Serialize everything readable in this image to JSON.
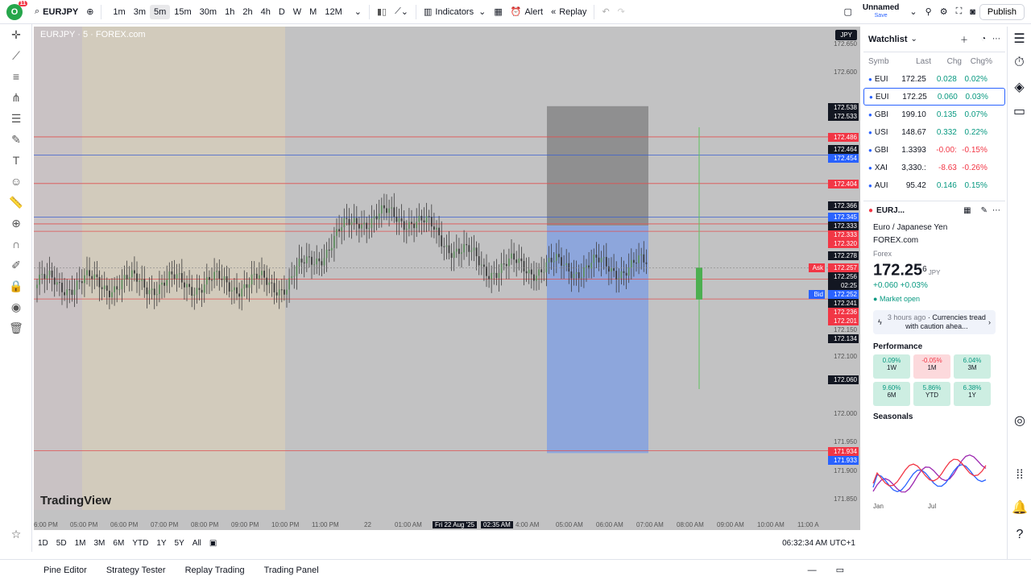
{
  "topbar": {
    "logo_badge": "11",
    "symbol": "EURJPY",
    "timeframes": [
      "1m",
      "3m",
      "5m",
      "15m",
      "30m",
      "1h",
      "2h",
      "4h",
      "D",
      "W",
      "M",
      "12M"
    ],
    "active_tf": "5m",
    "indicators": "Indicators",
    "alert": "Alert",
    "replay": "Replay",
    "layout_name": "Unnamed",
    "layout_sub": "Save",
    "publish": "Publish"
  },
  "chart": {
    "symbol_label": "EURJPY · 5 · FOREX.com",
    "currency": "JPY",
    "watermark": "TradingView",
    "price_labels": [
      {
        "v": "172.650",
        "c": "none"
      },
      {
        "v": "172.600",
        "c": "none"
      },
      {
        "v": "172.538",
        "c": "black"
      },
      {
        "v": "172.533",
        "c": "black"
      },
      {
        "v": "172.486",
        "c": "red"
      },
      {
        "v": "172.464",
        "c": "black"
      },
      {
        "v": "172.454",
        "c": "blue"
      },
      {
        "v": "172.404",
        "c": "red"
      },
      {
        "v": "172.366",
        "c": "black"
      },
      {
        "v": "172.345",
        "c": "blue"
      },
      {
        "v": "172.333",
        "c": "black"
      },
      {
        "v": "172.333",
        "c": "red"
      },
      {
        "v": "172.320",
        "c": "red"
      },
      {
        "v": "172.278",
        "c": "black"
      },
      {
        "v": "172.257",
        "c": "red"
      },
      {
        "v": "172.256",
        "c": "black"
      },
      {
        "v": "02:25",
        "c": "black"
      },
      {
        "v": "172.252",
        "c": "blue"
      },
      {
        "v": "172.241",
        "c": "black"
      },
      {
        "v": "172.236",
        "c": "red"
      },
      {
        "v": "172.201",
        "c": "red"
      },
      {
        "v": "172.150",
        "c": "none"
      },
      {
        "v": "172.134",
        "c": "black"
      },
      {
        "v": "172.100",
        "c": "none"
      },
      {
        "v": "172.060",
        "c": "black"
      },
      {
        "v": "172.000",
        "c": "none"
      },
      {
        "v": "171.950",
        "c": "none"
      },
      {
        "v": "171.934",
        "c": "red"
      },
      {
        "v": "171.933",
        "c": "blue"
      },
      {
        "v": "171.900",
        "c": "none"
      },
      {
        "v": "171.850",
        "c": "none"
      }
    ],
    "ask": "Ask",
    "bid": "Bid",
    "time_labels": [
      "6:00 PM",
      "05:00 PM",
      "06:00 PM",
      "07:00 PM",
      "08:00 PM",
      "09:00 PM",
      "10:00 PM",
      "11:00 PM",
      "22",
      "01:00 AM",
      "Fri 22 Aug '25",
      "02:35 AM",
      "4:00 AM",
      "05:00 AM",
      "06:00 AM",
      "07:00 AM",
      "08:00 AM",
      "09:00 AM",
      "10:00 AM",
      "11:00 A"
    ]
  },
  "bottom": {
    "ranges": [
      "1D",
      "5D",
      "1M",
      "3M",
      "6M",
      "YTD",
      "1Y",
      "5Y",
      "All"
    ],
    "clock": "06:32:34 AM UTC+1"
  },
  "panels": [
    "Pine Editor",
    "Strategy Tester",
    "Replay Trading",
    "Trading Panel"
  ],
  "watchlist": {
    "title": "Watchlist",
    "headers": [
      "Symb",
      "Last",
      "Chg",
      "Chg%"
    ],
    "rows": [
      {
        "sym": "EUI",
        "last": "172.25",
        "chg": "0.028",
        "pct": "0.02%",
        "dir": "pos"
      },
      {
        "sym": "EUI",
        "last": "172.25",
        "chg": "0.060",
        "pct": "0.03%",
        "dir": "pos"
      },
      {
        "sym": "GBI",
        "last": "199.10",
        "chg": "0.135",
        "pct": "0.07%",
        "dir": "pos"
      },
      {
        "sym": "USI",
        "last": "148.67",
        "chg": "0.332",
        "pct": "0.22%",
        "dir": "pos"
      },
      {
        "sym": "GBI",
        "last": "1.3393",
        "chg": "-0.00:",
        "pct": "-0.15%",
        "dir": "neg"
      },
      {
        "sym": "XAI",
        "last": "3,330.:",
        "chg": "-8.63",
        "pct": "-0.26%",
        "dir": "neg"
      },
      {
        "sym": "AUI",
        "last": "95.42",
        "chg": "0.146",
        "pct": "0.15%",
        "dir": "pos"
      }
    ]
  },
  "details": {
    "symbol": "EURJ...",
    "name": "Euro / Japanese Yen",
    "exchange": "FOREX.com",
    "type": "Forex",
    "price": "172.25",
    "price_sup": "6",
    "currency": "JPY",
    "change": "+0.060",
    "change_pct": "+0.03%",
    "status": "Market open",
    "news_time": "3 hours ago",
    "news": "Currencies tread with caution ahea...",
    "performance_title": "Performance",
    "performance": [
      {
        "v": "0.09%",
        "p": "1W",
        "c": "g"
      },
      {
        "v": "-0.05%",
        "p": "1M",
        "c": "r"
      },
      {
        "v": "6.04%",
        "p": "3M",
        "c": "g"
      },
      {
        "v": "9.60%",
        "p": "6M",
        "c": "g"
      },
      {
        "v": "5.86%",
        "p": "YTD",
        "c": "g"
      },
      {
        "v": "6.38%",
        "p": "1Y",
        "c": "g"
      }
    ],
    "seasonals_title": "Seasonals",
    "season_x": [
      "Jan",
      "Jul"
    ]
  }
}
